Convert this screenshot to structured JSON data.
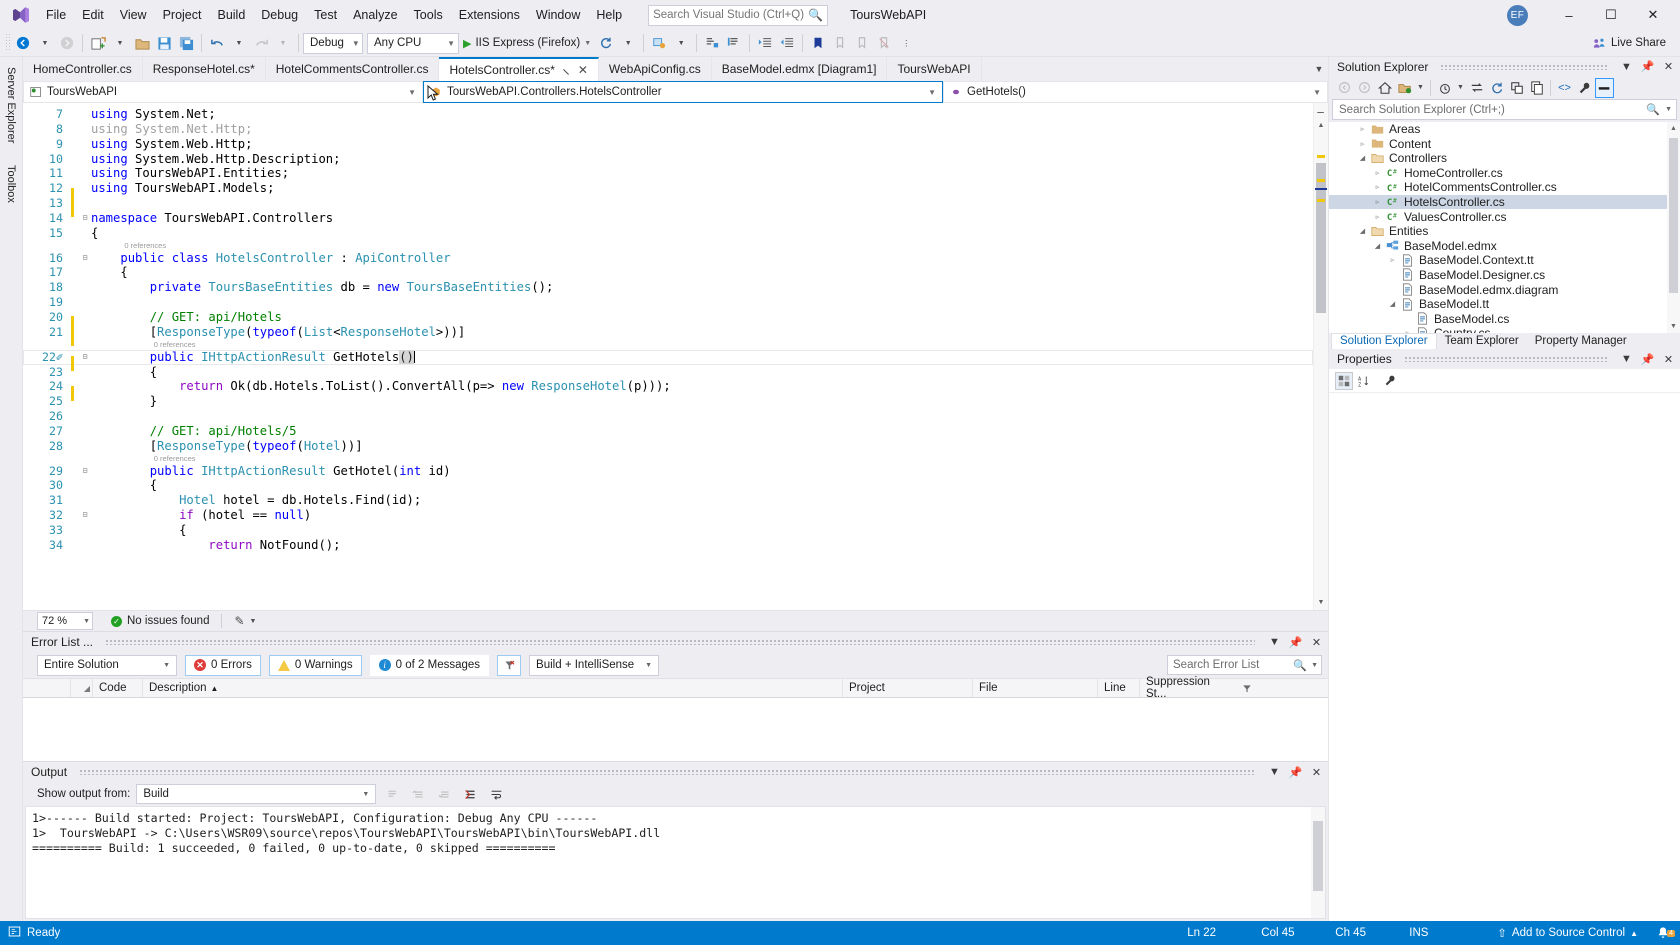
{
  "app": {
    "title": "ToursWebAPI",
    "logo_icon": "visual-studio-logo-icon",
    "avatar_initials": "EF"
  },
  "menu": {
    "items": [
      "File",
      "Edit",
      "View",
      "Project",
      "Build",
      "Debug",
      "Test",
      "Analyze",
      "Tools",
      "Extensions",
      "Window",
      "Help"
    ]
  },
  "search": {
    "placeholder": "Search Visual Studio (Ctrl+Q)",
    "icon": "search-icon"
  },
  "window_controls": {
    "minimize": "–",
    "maximize": "☐",
    "close": "✕"
  },
  "toolbar": {
    "navigate_back_icon": "navigate-back-icon",
    "navigate_forward_icon": "navigate-forward-icon",
    "new_project_icon": "new-project-icon",
    "open_file_icon": "open-file-icon",
    "save_icon": "save-icon",
    "save_all_icon": "save-all-icon",
    "undo_icon": "undo-icon",
    "redo_icon": "redo-icon",
    "configuration": "Debug",
    "platform": "Any CPU",
    "start_label": "IIS Express (Firefox)",
    "start_icon": "play-triangle-icon",
    "refresh_icon": "refresh-icon",
    "attach_icon": "attach-to-process-icon",
    "comment_icon": "comment-selection-icon",
    "uncomment_icon": "uncomment-selection-icon",
    "indent_icon": "increase-indent-icon",
    "outdent_icon": "decrease-indent-icon",
    "bookmark_icon": "bookmark-icon",
    "prev_bookmark_icon": "previous-bookmark-icon",
    "next_bookmark_icon": "next-bookmark-icon",
    "clear_bookmark_icon": "clear-bookmarks-icon",
    "live_share_label": "Live Share",
    "live_share_icon": "live-share-icon"
  },
  "left_rail": {
    "tabs": [
      "Server Explorer",
      "Toolbox"
    ]
  },
  "document_tabs": [
    {
      "label": "HomeController.cs",
      "active": false
    },
    {
      "label": "ResponseHotel.cs*",
      "active": false
    },
    {
      "label": "HotelCommentsController.cs",
      "active": false
    },
    {
      "label": "HotelsController.cs*",
      "active": true
    },
    {
      "label": "WebApiConfig.cs",
      "active": false
    },
    {
      "label": "BaseModel.edmx [Diagram1]",
      "active": false
    },
    {
      "label": "ToursWebAPI",
      "active": false
    }
  ],
  "navbar": {
    "project": "ToursWebAPI",
    "project_icon": "project-icon",
    "type": "ToursWebAPI.Controllers.HotelsController",
    "type_icon": "class-icon",
    "member": "GetHotels()",
    "member_icon": "method-icon"
  },
  "editor": {
    "zoom": "72 %",
    "issues_status": "No issues found",
    "issues_icon": "check-circle-icon",
    "lines": [
      {
        "n": 7,
        "mark": "none",
        "fold": "",
        "tokens": [
          [
            "kw",
            "using"
          ],
          [
            "plain",
            " System.Net;"
          ]
        ]
      },
      {
        "n": 8,
        "mark": "none",
        "fold": "",
        "tokens": [
          [
            "dim",
            "using System.Net.Http;"
          ]
        ]
      },
      {
        "n": 9,
        "mark": "none",
        "fold": "",
        "tokens": [
          [
            "kw",
            "using"
          ],
          [
            "plain",
            " System.Web.Http;"
          ]
        ]
      },
      {
        "n": 10,
        "mark": "none",
        "fold": "",
        "tokens": [
          [
            "kw",
            "using"
          ],
          [
            "plain",
            " System.Web.Http.Description;"
          ]
        ]
      },
      {
        "n": 11,
        "mark": "none",
        "fold": "",
        "tokens": [
          [
            "kw",
            "using"
          ],
          [
            "plain",
            " ToursWebAPI.Entities;"
          ]
        ]
      },
      {
        "n": 12,
        "mark": "changed",
        "fold": "",
        "tokens": [
          [
            "kw",
            "using"
          ],
          [
            "plain",
            " ToursWebAPI.Models;"
          ]
        ]
      },
      {
        "n": 13,
        "mark": "changed",
        "fold": "",
        "tokens": []
      },
      {
        "n": 14,
        "mark": "none",
        "fold": "-",
        "tokens": [
          [
            "kw",
            "namespace"
          ],
          [
            "plain",
            " ToursWebAPI.Controllers"
          ]
        ]
      },
      {
        "n": 15,
        "mark": "none",
        "fold": "",
        "tokens": [
          [
            "plain",
            "{"
          ]
        ]
      },
      {
        "n": 16,
        "mark": "none",
        "fold": "-",
        "refs": "0 references",
        "indent": 4,
        "tokens": [
          [
            "kw",
            "public"
          ],
          [
            "plain",
            " "
          ],
          [
            "kw",
            "class"
          ],
          [
            "plain",
            " "
          ],
          [
            "typ",
            "HotelsController"
          ],
          [
            "plain",
            " : "
          ],
          [
            "typ",
            "ApiController"
          ]
        ]
      },
      {
        "n": 17,
        "mark": "none",
        "fold": "",
        "indent": 4,
        "tokens": [
          [
            "plain",
            "{"
          ]
        ]
      },
      {
        "n": 18,
        "mark": "none",
        "fold": "",
        "indent": 8,
        "tokens": [
          [
            "kw",
            "private"
          ],
          [
            "plain",
            " "
          ],
          [
            "typ",
            "ToursBaseEntities"
          ],
          [
            "plain",
            " db = "
          ],
          [
            "kw",
            "new"
          ],
          [
            "plain",
            " "
          ],
          [
            "typ",
            "ToursBaseEntities"
          ],
          [
            "plain",
            "();"
          ]
        ]
      },
      {
        "n": 19,
        "mark": "none",
        "fold": "",
        "indent": 8,
        "tokens": []
      },
      {
        "n": 20,
        "mark": "changed",
        "fold": "",
        "indent": 8,
        "tokens": [
          [
            "cmt",
            "// GET: api/Hotels"
          ]
        ]
      },
      {
        "n": 21,
        "mark": "changed",
        "fold": "",
        "indent": 8,
        "tokens": [
          [
            "plain",
            "["
          ],
          [
            "typ",
            "ResponseType"
          ],
          [
            "plain",
            "("
          ],
          [
            "kw",
            "typeof"
          ],
          [
            "plain",
            "("
          ],
          [
            "typ",
            "List"
          ],
          [
            "plain",
            "<"
          ],
          [
            "typ",
            "ResponseHotel"
          ],
          [
            "plain",
            ">))]"
          ]
        ]
      },
      {
        "n": 22,
        "mark": "changed",
        "fold": "-",
        "refs": "0 references",
        "indent": 8,
        "current": true,
        "edited": true,
        "tokens": [
          [
            "kw",
            "public"
          ],
          [
            "plain",
            " "
          ],
          [
            "typ",
            "IHttpActionResult"
          ],
          [
            "plain",
            " GetHotels"
          ],
          [
            "sel",
            "()"
          ]
        ]
      },
      {
        "n": 23,
        "mark": "none",
        "fold": "",
        "indent": 8,
        "tokens": [
          [
            "plain",
            "{"
          ]
        ]
      },
      {
        "n": 24,
        "mark": "changed",
        "fold": "",
        "indent": 12,
        "tokens": [
          [
            "ctl",
            "return"
          ],
          [
            "plain",
            " Ok(db.Hotels.ToList().ConvertAll(p=> "
          ],
          [
            "kw",
            "new"
          ],
          [
            "plain",
            " "
          ],
          [
            "typ",
            "ResponseHotel"
          ],
          [
            "plain",
            "(p)));"
          ]
        ]
      },
      {
        "n": 25,
        "mark": "none",
        "fold": "",
        "indent": 8,
        "tokens": [
          [
            "plain",
            "}"
          ]
        ]
      },
      {
        "n": 26,
        "mark": "none",
        "fold": "",
        "indent": 8,
        "tokens": []
      },
      {
        "n": 27,
        "mark": "none",
        "fold": "",
        "indent": 8,
        "tokens": [
          [
            "cmt",
            "// GET: api/Hotels/5"
          ]
        ]
      },
      {
        "n": 28,
        "mark": "none",
        "fold": "",
        "indent": 8,
        "tokens": [
          [
            "plain",
            "["
          ],
          [
            "typ",
            "ResponseType"
          ],
          [
            "plain",
            "("
          ],
          [
            "kw",
            "typeof"
          ],
          [
            "plain",
            "("
          ],
          [
            "typ",
            "Hotel"
          ],
          [
            "plain",
            "))]"
          ]
        ]
      },
      {
        "n": 29,
        "mark": "none",
        "fold": "-",
        "refs": "0 references",
        "indent": 8,
        "tokens": [
          [
            "kw",
            "public"
          ],
          [
            "plain",
            " "
          ],
          [
            "typ",
            "IHttpActionResult"
          ],
          [
            "plain",
            " GetHotel("
          ],
          [
            "kw",
            "int"
          ],
          [
            "plain",
            " id)"
          ]
        ]
      },
      {
        "n": 30,
        "mark": "none",
        "fold": "",
        "indent": 8,
        "tokens": [
          [
            "plain",
            "{"
          ]
        ]
      },
      {
        "n": 31,
        "mark": "none",
        "fold": "",
        "indent": 12,
        "tokens": [
          [
            "typ",
            "Hotel"
          ],
          [
            "plain",
            " hotel = db.Hotels.Find(id);"
          ]
        ]
      },
      {
        "n": 32,
        "mark": "none",
        "fold": "-",
        "indent": 12,
        "tokens": [
          [
            "ctl",
            "if"
          ],
          [
            "plain",
            " (hotel == "
          ],
          [
            "kw",
            "null"
          ],
          [
            "plain",
            ")"
          ]
        ]
      },
      {
        "n": 33,
        "mark": "none",
        "fold": "",
        "indent": 12,
        "tokens": [
          [
            "plain",
            "{"
          ]
        ]
      },
      {
        "n": 34,
        "mark": "none",
        "fold": "",
        "indent": 16,
        "tokens": [
          [
            "ctl",
            "return"
          ],
          [
            "plain",
            " NotFound();"
          ]
        ]
      }
    ]
  },
  "error_list": {
    "title": "Error List ...",
    "scope": "Entire Solution",
    "errors": "0 Errors",
    "warnings": "0 Warnings",
    "messages": "0 of 2 Messages",
    "filter_icon": "clear-filter-icon",
    "source": "Build + IntelliSense",
    "search_placeholder": "Search Error List",
    "columns": [
      "",
      "Code",
      "Description",
      "Project",
      "File",
      "Line",
      "Suppression St..."
    ],
    "sort_indicator": "▲",
    "rows": []
  },
  "output": {
    "title": "Output",
    "show_from_label": "Show output from:",
    "show_from_value": "Build",
    "buttons": [
      "find-message-icon",
      "go-to-previous-icon",
      "go-to-next-icon",
      "clear-all-icon",
      "toggle-word-wrap-icon"
    ],
    "lines": [
      "1>------ Build started: Project: ToursWebAPI, Configuration: Debug Any CPU ------",
      "1>  ToursWebAPI -> C:\\Users\\WSR09\\source\\repos\\ToursWebAPI\\ToursWebAPI\\bin\\ToursWebAPI.dll",
      "========== Build: 1 succeeded, 0 failed, 0 up-to-date, 0 skipped =========="
    ]
  },
  "solution_explorer": {
    "title": "Solution Explorer",
    "search_placeholder": "Search Solution Explorer (Ctrl+;)",
    "toolbar_icons": [
      "back-icon",
      "forward-icon",
      "home-icon",
      "pending-changes-icon",
      "sync-with-active-document-icon",
      "refresh-icon",
      "collapse-all-icon",
      "show-all-files-icon",
      "view-code-icon",
      "properties-icon",
      "preview-selected-items-icon"
    ],
    "tree": [
      {
        "label": "Areas",
        "indent": 1,
        "arrow": "collapsed",
        "icon": "folder-icon",
        "selected": false
      },
      {
        "label": "Content",
        "indent": 1,
        "arrow": "collapsed",
        "icon": "folder-icon",
        "selected": false
      },
      {
        "label": "Controllers",
        "indent": 1,
        "arrow": "expanded",
        "icon": "folder-open-icon",
        "selected": false
      },
      {
        "label": "HomeController.cs",
        "indent": 2,
        "arrow": "collapsed",
        "icon": "csharp-icon",
        "selected": false
      },
      {
        "label": "HotelCommentsController.cs",
        "indent": 2,
        "arrow": "collapsed",
        "icon": "csharp-icon",
        "selected": false
      },
      {
        "label": "HotelsController.cs",
        "indent": 2,
        "arrow": "collapsed",
        "icon": "csharp-icon",
        "selected": true
      },
      {
        "label": "ValuesController.cs",
        "indent": 2,
        "arrow": "collapsed",
        "icon": "csharp-icon",
        "selected": false
      },
      {
        "label": "Entities",
        "indent": 1,
        "arrow": "expanded",
        "icon": "folder-open-icon",
        "selected": false
      },
      {
        "label": "BaseModel.edmx",
        "indent": 2,
        "arrow": "expanded",
        "icon": "edmx-icon",
        "selected": false
      },
      {
        "label": "BaseModel.Context.tt",
        "indent": 3,
        "arrow": "collapsed",
        "icon": "tt-file-icon",
        "selected": false
      },
      {
        "label": "BaseModel.Designer.cs",
        "indent": 3,
        "arrow": "none",
        "icon": "tt-file-icon",
        "selected": false
      },
      {
        "label": "BaseModel.edmx.diagram",
        "indent": 3,
        "arrow": "none",
        "icon": "tt-file-icon",
        "selected": false
      },
      {
        "label": "BaseModel.tt",
        "indent": 3,
        "arrow": "expanded",
        "icon": "tt-file-icon",
        "selected": false
      },
      {
        "label": "BaseModel.cs",
        "indent": 4,
        "arrow": "none",
        "icon": "tt-file-icon",
        "selected": false
      },
      {
        "label": "Country.cs",
        "indent": 4,
        "arrow": "collapsed",
        "icon": "tt-file-icon",
        "selected": false
      }
    ],
    "tabs": [
      {
        "label": "Solution Explorer",
        "active": true
      },
      {
        "label": "Team Explorer",
        "active": false
      },
      {
        "label": "Property Manager",
        "active": false
      }
    ]
  },
  "properties": {
    "title": "Properties",
    "toolbar_icons": [
      "categorized-icon",
      "alphabetical-icon",
      "property-pages-icon"
    ]
  },
  "status_bar": {
    "ready": "Ready",
    "ready_icon": "source-control-icon",
    "line": "Ln 22",
    "column": "Col 45",
    "char": "Ch 45",
    "insert_mode": "INS",
    "add_to_source_control": "Add to Source Control",
    "add_icon": "up-arrow-icon",
    "notification_icon": "bell-icon",
    "notification_count": "4"
  },
  "colors": {
    "accent": "#007acc",
    "chrome": "#eeeef2",
    "editor_bg": "#ffffff",
    "keyword": "#0000ff",
    "type": "#2b91af",
    "comment": "#008000",
    "control": "#8f08c4",
    "line_number": "#2b91af",
    "selection": "#cdd6e4",
    "changed_mark": "#f0c808",
    "error": "#e03b3b",
    "warning": "#f6c944",
    "info": "#1f8ad2",
    "success": "#22a022"
  }
}
